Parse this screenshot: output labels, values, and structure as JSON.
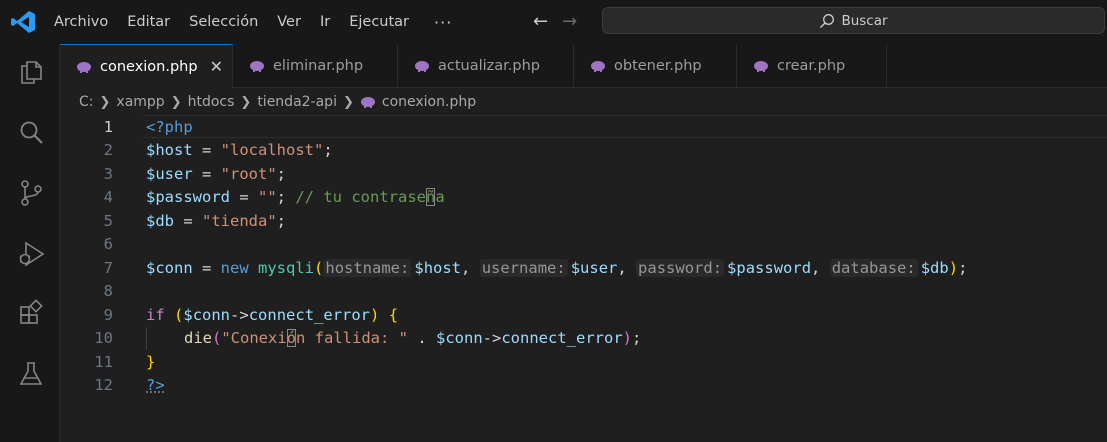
{
  "menu": {
    "items": [
      "Archivo",
      "Editar",
      "Selección",
      "Ver",
      "Ir",
      "Ejecutar"
    ],
    "more": "···"
  },
  "search": {
    "label": "Buscar"
  },
  "tabs": [
    {
      "label": "conexion.php",
      "active": true
    },
    {
      "label": "eliminar.php"
    },
    {
      "label": "actualizar.php"
    },
    {
      "label": "obtener.php"
    },
    {
      "label": "crear.php"
    }
  ],
  "breadcrumb": [
    "C:",
    "xampp",
    "htdocs",
    "tienda2-api",
    "conexion.php"
  ],
  "editor": {
    "line_numbers": [
      "1",
      "2",
      "3",
      "4",
      "5",
      "6",
      "7",
      "8",
      "9",
      "10",
      "11",
      "12"
    ],
    "l1": {
      "open": "<?php"
    },
    "l2": {
      "var": "$host",
      "eq": " = ",
      "str": "\"localhost\"",
      "end": ";"
    },
    "l3": {
      "var": "$user",
      "eq": " = ",
      "str": "\"root\"",
      "end": ";"
    },
    "l4": {
      "var": "$password",
      "eq": " = ",
      "str": "\"\"",
      "end": "; ",
      "cmt_a": "// tu contrase",
      "cmt_b": "ñ",
      "cmt_c": "a"
    },
    "l5": {
      "var": "$db",
      "eq": " = ",
      "str": "\"tienda\"",
      "end": ";"
    },
    "l7": {
      "var": "$conn",
      "eq": " = ",
      "kw": "new",
      "cls": "mysqli",
      "h1": "hostname:",
      "a1": "$host",
      "h2": "username:",
      "a2": "$user",
      "h3": "password:",
      "a3": "$password",
      "h4": "database:",
      "a4": "$db",
      "comma": ", ",
      "end": ");"
    },
    "l9": {
      "kw": "if",
      "var": "$conn",
      "arrow": "->",
      "prop": "connect_error",
      "brace": "{"
    },
    "l10": {
      "fn": "die",
      "str_a": "\"Conexi",
      "str_b": "ó",
      "str_c": "n fallida: \"",
      "dot": " . ",
      "var": "$conn",
      "arrow": "->",
      "prop": "connect_error",
      "end": ");"
    },
    "l11": {
      "brace": "}"
    },
    "l12": {
      "close": "?>"
    }
  }
}
